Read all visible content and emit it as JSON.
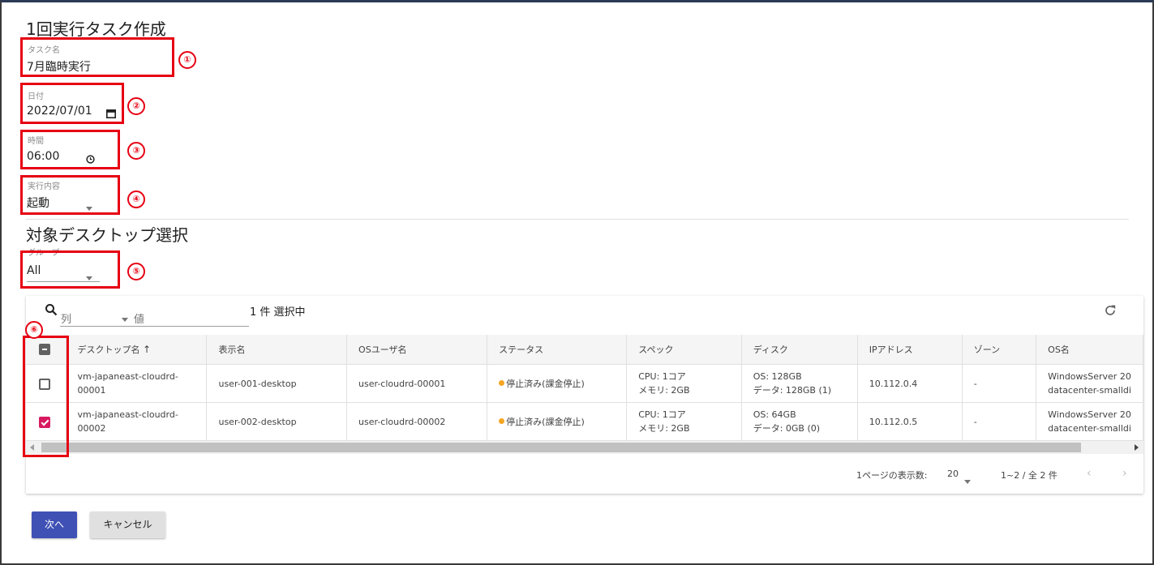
{
  "page_title": "1回実行タスク作成",
  "task_name": {
    "label": "タスク名",
    "value": "7月臨時実行"
  },
  "date": {
    "label": "日付",
    "value": "2022/07/01"
  },
  "time": {
    "label": "時間",
    "value": "06:00"
  },
  "action": {
    "label": "実行内容",
    "value": "起動"
  },
  "section_title": "対象デスクトップ選択",
  "group": {
    "label": "グループ",
    "value": "All"
  },
  "annotations": [
    "①",
    "②",
    "③",
    "④",
    "⑤",
    "⑥"
  ],
  "toolbar": {
    "column_placeholder": "列",
    "value_placeholder": "値",
    "selected_count": "1 件 選択中"
  },
  "table": {
    "columns": [
      "デスクトップ名",
      "表示名",
      "OSユーザ名",
      "ステータス",
      "スペック",
      "ディスク",
      "IPアドレス",
      "ゾーン",
      "OS名"
    ],
    "sort_indicator": "↑",
    "rows": [
      {
        "checked": false,
        "desktop_name_1": "vm-japaneast-cloudrd-",
        "desktop_name_2": "00001",
        "display_name": "user-001-desktop",
        "os_user": "user-cloudrd-00001",
        "status": "停止済み(課金停止)",
        "spec_1": "CPU: 1コア",
        "spec_2": "メモリ: 2GB",
        "disk_1": "OS: 128GB",
        "disk_2": "データ: 128GB (1)",
        "ip": "10.112.0.4",
        "zone": "-",
        "os_1": "WindowsServer 20",
        "os_2": "datacenter-smalldi"
      },
      {
        "checked": true,
        "desktop_name_1": "vm-japaneast-cloudrd-",
        "desktop_name_2": "00002",
        "display_name": "user-002-desktop",
        "os_user": "user-cloudrd-00002",
        "status": "停止済み(課金停止)",
        "spec_1": "CPU: 1コア",
        "spec_2": "メモリ: 2GB",
        "disk_1": "OS: 64GB",
        "disk_2": "データ: 0GB (0)",
        "ip": "10.112.0.5",
        "zone": "-",
        "os_1": "WindowsServer 20",
        "os_2": "datacenter-smalldi"
      }
    ]
  },
  "pagination": {
    "rows_per_page_label": "1ページの表示数:",
    "rows_per_page": "20",
    "range": "1~2 / 全 2 件"
  },
  "buttons": {
    "next": "次へ",
    "cancel": "キャンセル"
  },
  "colors": {
    "annotation": "#e60012",
    "primary": "#3f51b5",
    "checkbox_checked": "#d81b60",
    "status_dot": "#f5a623"
  }
}
